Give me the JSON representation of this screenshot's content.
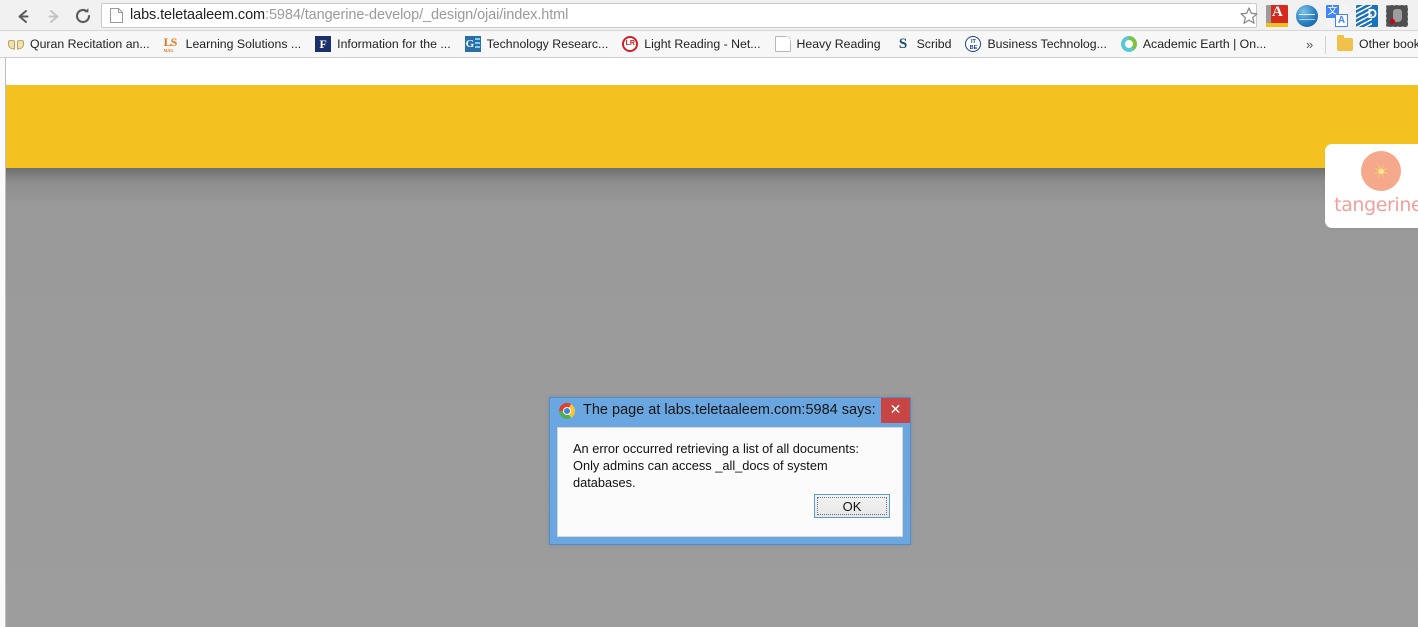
{
  "browser": {
    "nav": {
      "back_label": "Back",
      "forward_label": "Forward",
      "reload_label": "Reload"
    },
    "omnibox": {
      "host": "labs.teletaaleem.com",
      "path": ":5984/tangerine-develop/_design/ojai/index.html",
      "full_url": "labs.teletaaleem.com:5984/tangerine-develop/_design/ojai/index.html",
      "page_icon": "page-document-icon",
      "bookmark_icon": "star-icon"
    },
    "extensions": [
      {
        "name": "dictionary-extension-icon",
        "icon": "red-book-icon"
      },
      {
        "name": "globe-extension-icon",
        "icon": "blue-globe-icon"
      },
      {
        "name": "translate-extension-icon",
        "icon": "google-translate-icon",
        "glyph_primary": "文",
        "glyph_secondary": "A"
      },
      {
        "name": "dictionary-com-extension-icon",
        "icon": "blue-d-icon",
        "glyph": "D"
      },
      {
        "name": "evernote-extension-icon",
        "icon": "elephant-icon"
      }
    ],
    "bookmarks": [
      {
        "label": "Quran Recitation an...",
        "icon": "open-book-icon"
      },
      {
        "label": "Learning Solutions ...",
        "icon": "ls-logo-icon",
        "glyph": "LS",
        "subglyph": "MAG"
      },
      {
        "label": "Information for the ...",
        "icon": "blue-f-icon",
        "glyph": "F"
      },
      {
        "label": "Technology Researc...",
        "icon": "gartner-icon",
        "glyph": "G"
      },
      {
        "label": "Light Reading - Net...",
        "icon": "lr-circle-icon",
        "glyph": "LR"
      },
      {
        "label": "Heavy Reading",
        "icon": "document-icon"
      },
      {
        "label": "Scribd",
        "icon": "scribd-icon",
        "glyph": "S"
      },
      {
        "label": "Business Technolog...",
        "icon": "itbe-circle-icon",
        "glyph": "IT",
        "subglyph": "BE"
      },
      {
        "label": "Academic Earth | On...",
        "icon": "academic-earth-icon"
      }
    ],
    "bookmarks_overflow": "»",
    "other_bookmarks": {
      "label": "Other bookmarks",
      "icon": "folder-icon"
    }
  },
  "page": {
    "header_color": "#f3c220",
    "body_color": "#9a9a9a",
    "logo": {
      "wordmark": "tangerine",
      "trademark": "™",
      "icon": "citrus-slice-icon",
      "wordmark_color": "#f3a09a",
      "fruit_color": "#f5a98c"
    }
  },
  "dialog": {
    "title": "The page at labs.teletaaleem.com:5984 says:",
    "icon": "chrome-logo-icon",
    "close_label": "✕",
    "message": "An error occurred retrieving a list of all documents: Only admins can access _all_docs of system databases.",
    "ok_label": "OK",
    "titlebar_color": "#6aa7e0",
    "close_color": "#c74545"
  }
}
